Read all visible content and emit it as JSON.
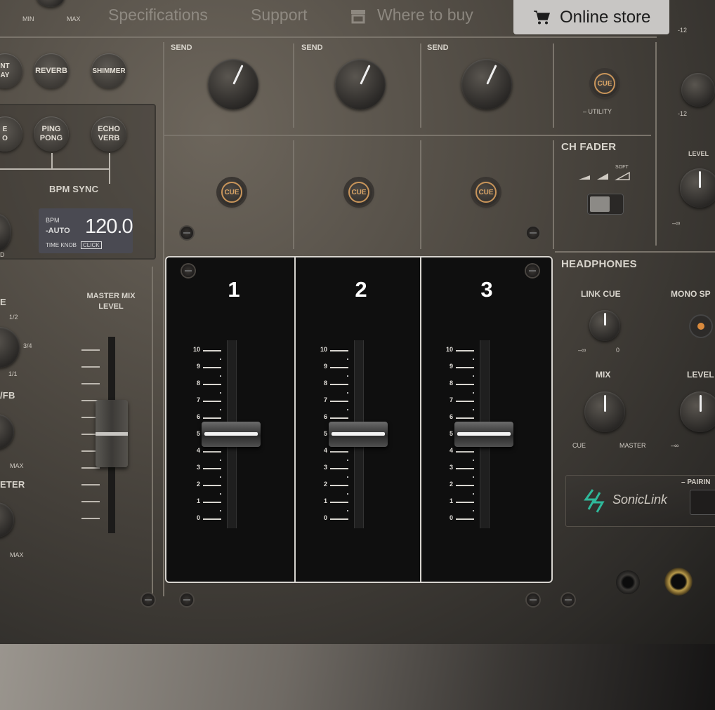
{
  "nav": {
    "items": [
      "Specifications",
      "Support",
      "Where to buy"
    ],
    "store_label": "Online store"
  },
  "top_left": {
    "min": "MIN",
    "max": "MAX"
  },
  "fx_buttons": [
    "REVERB",
    "SHIMMER",
    "PING\nPONG",
    "ECHO\nVERB"
  ],
  "fx_partial": [
    "NT\nAY",
    "E\nO"
  ],
  "bpm_sync": "BPM SYNC",
  "lcd": {
    "bpm": "BPM",
    "mode": "-AUTO",
    "value": "120.0",
    "knob": "TIME KNOB",
    "click": "CLICK"
  },
  "master_mix_level": "MASTER MIX\nLEVEL",
  "left_partial": {
    "e": "E",
    "half": "1/2",
    "three_q": "3/4",
    "one": "1/1",
    "fb": "/FB",
    "max1": "MAX",
    "eter": "ETER",
    "max2": "MAX",
    "d": "D"
  },
  "send_label": "SEND",
  "utility": "– UTILITY",
  "cue_label": "CUE",
  "ch_fader": {
    "title": "CH FADER",
    "soft": "SOFT"
  },
  "right_partial": {
    "m12a": "-12",
    "m12b": "-12",
    "level": "LEVEL",
    "minf": "–∞"
  },
  "headphones": {
    "title": "HEADPHONES",
    "link_cue": "LINK CUE",
    "mono_split": "MONO SP",
    "minf": "–∞",
    "zero": "0",
    "mix": "MIX",
    "cue": "CUE",
    "master": "MASTER",
    "level": "LEVEL",
    "minf2": "–∞"
  },
  "soniclink": {
    "brand": "SonicLink",
    "pairing": "– PAIRIN"
  },
  "channels": [
    {
      "number": "1",
      "fader_value": 5
    },
    {
      "number": "2",
      "fader_value": 5
    },
    {
      "number": "3",
      "fader_value": 5
    }
  ],
  "fader_scale": [
    "10",
    "9",
    "8",
    "7",
    "6",
    "5",
    "4",
    "3",
    "2",
    "1",
    "0"
  ],
  "colors": {
    "cue_ring": "#c9955a",
    "soniclink": "#2fb89a",
    "store_bg": "#c8c6c4"
  }
}
